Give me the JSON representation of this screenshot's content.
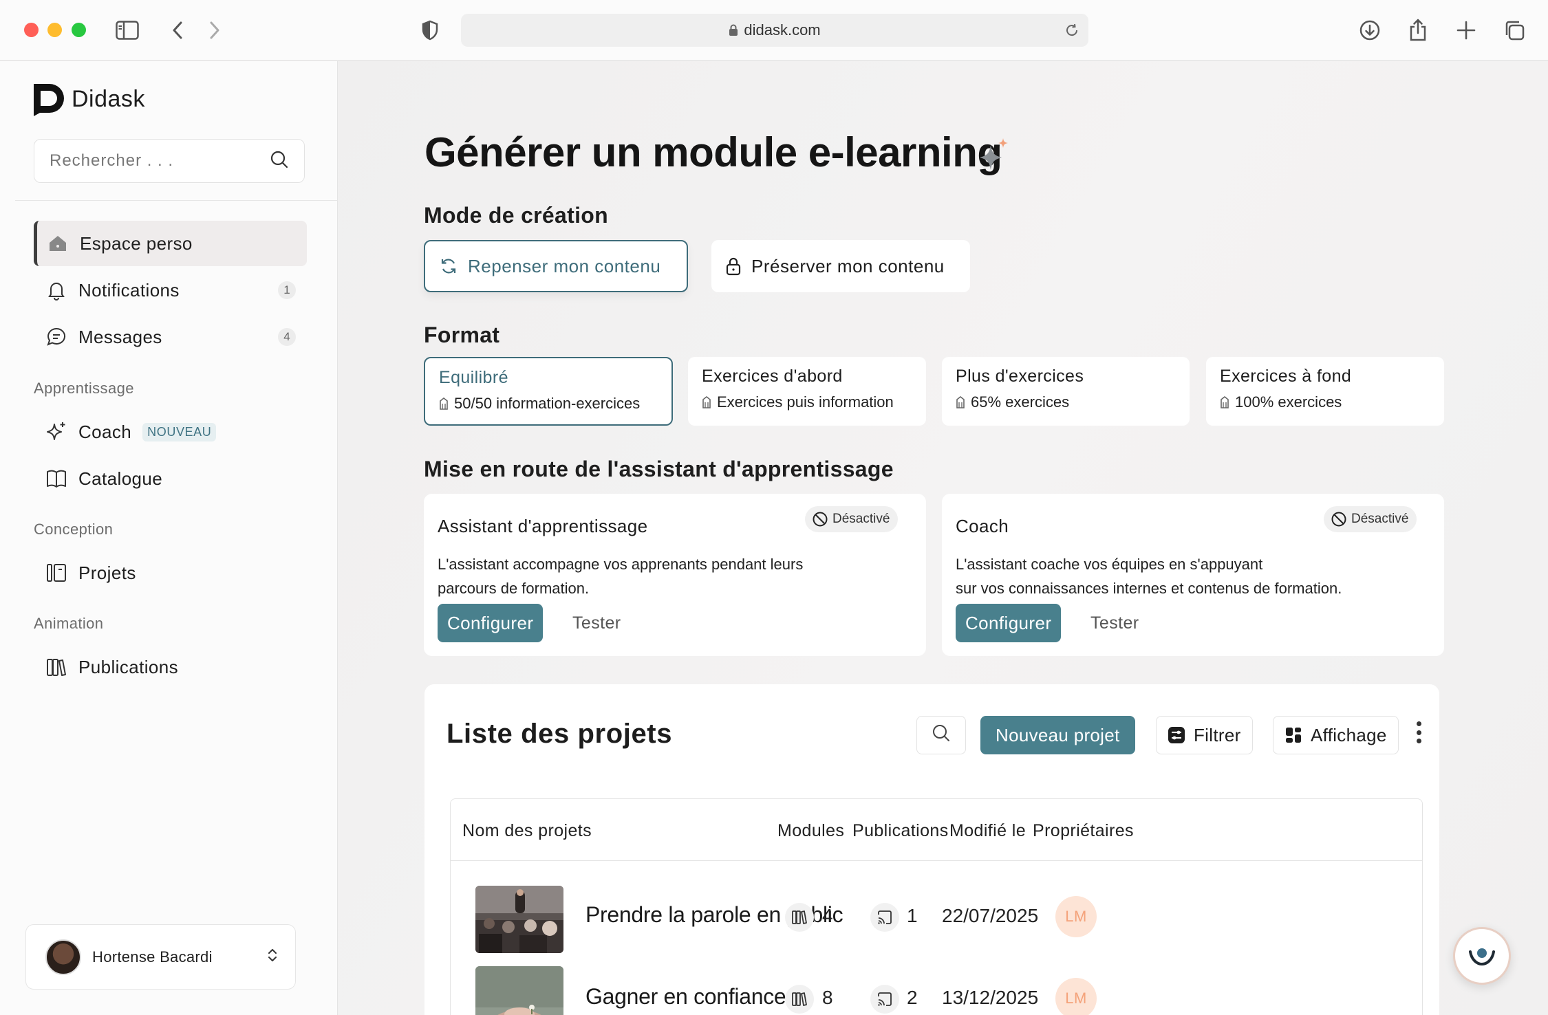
{
  "browser": {
    "url": "didask.com"
  },
  "sidebar": {
    "brand": "Didask",
    "search_placeholder": "Rechercher . . .",
    "items": [
      {
        "label": "Espace perso"
      },
      {
        "label": "Notifications",
        "count": "1"
      },
      {
        "label": "Messages",
        "count": "4"
      }
    ],
    "sections": [
      {
        "label": "Apprentissage",
        "items": [
          {
            "label": "Coach",
            "badge": "NOUVEAU"
          },
          {
            "label": "Catalogue"
          }
        ]
      },
      {
        "label": "Conception",
        "items": [
          {
            "label": "Projets"
          }
        ]
      },
      {
        "label": "Animation",
        "items": [
          {
            "label": "Publications"
          }
        ]
      }
    ],
    "user": {
      "name": "Hortense Bacardi"
    }
  },
  "main": {
    "title": "Générer un module e-learning",
    "mode": {
      "heading": "Mode de création",
      "options": [
        {
          "label": "Repenser mon contenu",
          "selected": true
        },
        {
          "label": "Préserver mon contenu",
          "selected": false
        }
      ]
    },
    "format": {
      "heading": "Format",
      "options": [
        {
          "title": "Equilibré",
          "sub": "50/50 information-exercices",
          "selected": true
        },
        {
          "title": "Exercices d'abord",
          "sub": "Exercices puis information",
          "selected": false
        },
        {
          "title": "Plus d'exercices",
          "sub": "65% exercices",
          "selected": false
        },
        {
          "title": "Exercices à fond",
          "sub": "100% exercices",
          "selected": false
        }
      ]
    },
    "assistant": {
      "heading": "Mise en route de l'assistant d'apprentissage",
      "cards": [
        {
          "title": "Assistant d'apprentissage",
          "status": "Désactivé",
          "desc_1": "L'assistant accompagne vos apprenants pendant leurs",
          "desc_2": "parcours de formation.",
          "configure": "Configurer",
          "test": "Tester"
        },
        {
          "title": "Coach",
          "status": "Désactivé",
          "desc_1": "L'assistant coache vos équipes en s'appuyant",
          "desc_2": "sur vos connaissances internes et contenus de formation.",
          "configure": "Configurer",
          "test": "Tester"
        }
      ]
    },
    "projects": {
      "title": "Liste des projets",
      "new_button": "Nouveau projet",
      "filter_button": "Filtrer",
      "display_button": "Affichage",
      "columns": [
        "Nom des projets",
        "Modules",
        "Publications",
        "Modifié le",
        "Propriétaires"
      ],
      "rows": [
        {
          "name": "Prendre la parole en public",
          "modules": "4",
          "publications": "1",
          "modified": "22/07/2025",
          "owner": "LM"
        },
        {
          "name": "Gagner en confiance",
          "modules": "8",
          "publications": "2",
          "modified": "13/12/2025",
          "owner": "LM"
        }
      ]
    }
  },
  "colors": {
    "accent": "#49808d",
    "accent_dark": "#3e6c7a",
    "owner_bg": "#fde4d6",
    "owner_text": "#f4a27a"
  }
}
